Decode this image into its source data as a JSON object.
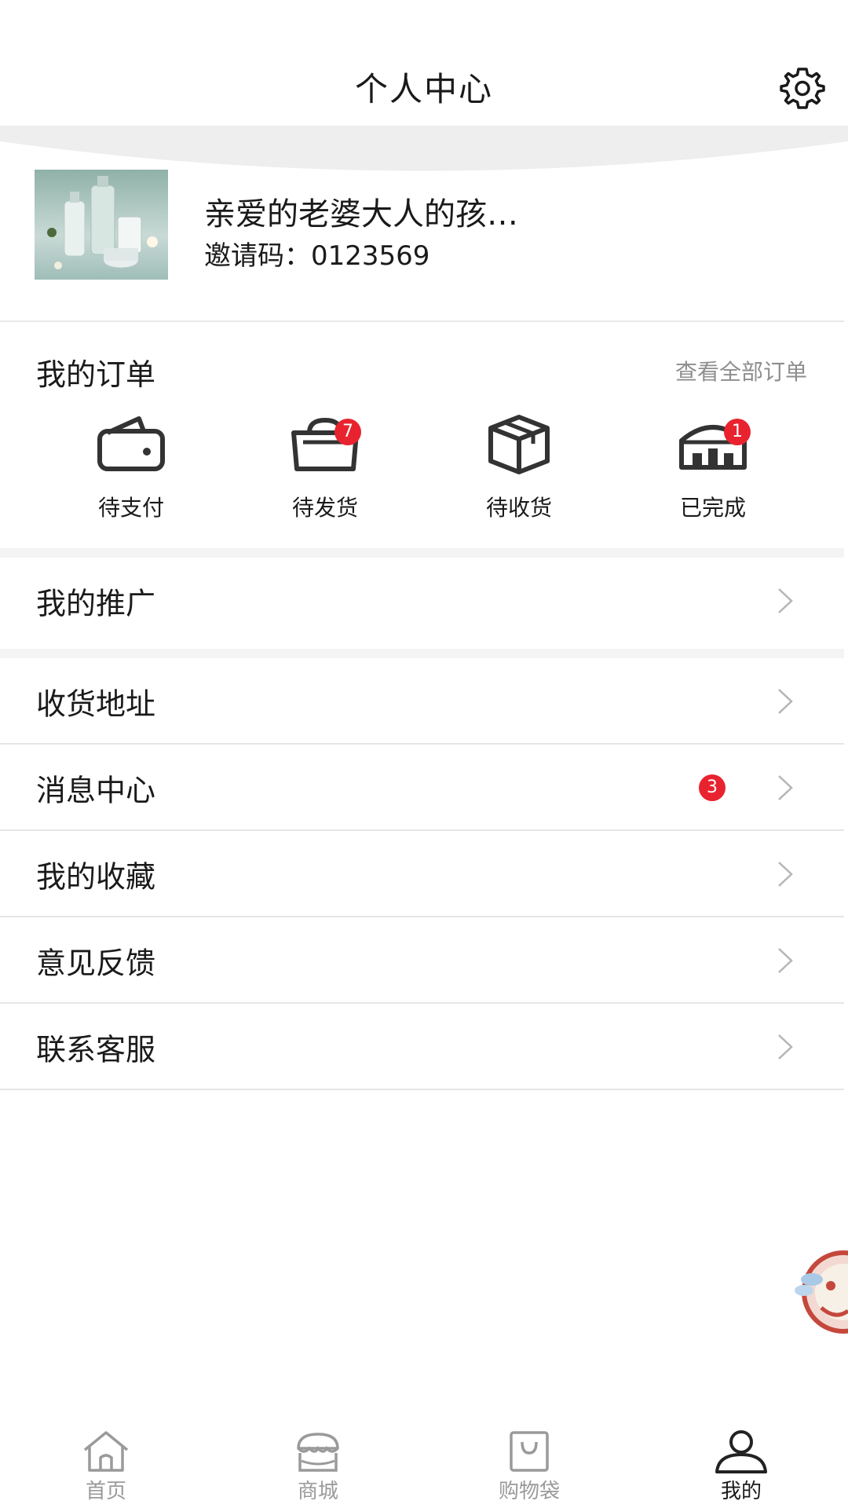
{
  "header": {
    "title": "个人中心",
    "settings_icon": "gear-icon"
  },
  "profile": {
    "name": "亲爱的老婆大人的孩…",
    "invite_label": "邀请码：",
    "invite_code": "0123569"
  },
  "orders": {
    "title": "我的订单",
    "view_all": "查看全部订单",
    "items": [
      {
        "label": "待支付",
        "icon": "wallet-icon",
        "badge": ""
      },
      {
        "label": "待发货",
        "icon": "basket-icon",
        "badge": "7"
      },
      {
        "label": "待收货",
        "icon": "box-icon",
        "badge": ""
      },
      {
        "label": "已完成",
        "icon": "shop-icon",
        "badge": "1"
      }
    ]
  },
  "menu": {
    "promotion": "我的推广",
    "address": "收货地址",
    "messages": "消息中心",
    "messages_badge": "3",
    "favorites": "我的收藏",
    "feedback": "意见反馈",
    "support": "联系客服"
  },
  "tabbar": {
    "items": [
      {
        "label": "首页",
        "icon": "home-icon",
        "active": false
      },
      {
        "label": "商城",
        "icon": "store-icon",
        "active": false
      },
      {
        "label": "购物袋",
        "icon": "shopping-bag-icon",
        "active": false
      },
      {
        "label": "我的",
        "icon": "user-icon",
        "active": true
      }
    ]
  },
  "colors": {
    "badge": "#e8232f",
    "text": "#1a1a1a",
    "muted": "#8e8e8e",
    "divider": "#e6e6e6"
  }
}
